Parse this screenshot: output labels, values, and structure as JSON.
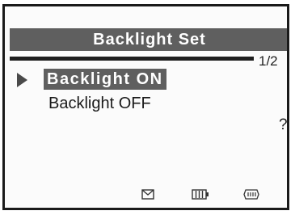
{
  "header": {
    "title": "Backlight Set"
  },
  "pagination": {
    "indicator": "1/2"
  },
  "menu": {
    "items": [
      {
        "label": "Backlight ON",
        "selected": true
      },
      {
        "label": "Backlight OFF",
        "selected": false
      }
    ]
  },
  "help": {
    "label": "?"
  },
  "status_bar": {
    "icons": [
      "envelope-icon",
      "battery-icon",
      "connector-icon"
    ]
  },
  "colors": {
    "highlight": "#5f5f5f",
    "background": "#fbfbfb",
    "text": "#1a1a1a"
  }
}
